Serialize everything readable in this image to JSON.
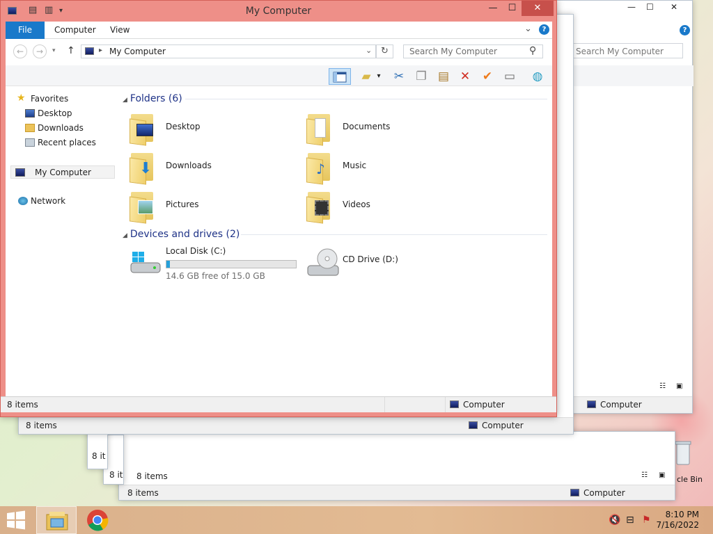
{
  "window": {
    "title": "My Computer",
    "caption_min": "—",
    "caption_max": "☐",
    "caption_close": "✕"
  },
  "ribbon": {
    "tabs": [
      "File",
      "Computer",
      "View"
    ],
    "help": "?",
    "chevron": "⌄"
  },
  "address": {
    "back": "←",
    "forward": "→",
    "up": "↑",
    "path": "My Computer",
    "refresh": "↻",
    "search_placeholder": "Search My Computer",
    "search_icon": "⚲"
  },
  "toolbar_icons": [
    "layout-icon",
    "properties-icon",
    "cut-icon",
    "copy-icon",
    "paste-icon",
    "delete-icon",
    "check-icon",
    "rename-icon",
    "globe-icon"
  ],
  "nav": {
    "favorites": "Favorites",
    "desktop": "Desktop",
    "downloads": "Downloads",
    "recent": "Recent places",
    "my_computer": "My Computer",
    "network": "Network"
  },
  "folders": {
    "header": "Folders (6)",
    "items": [
      "Desktop",
      "Documents",
      "Downloads",
      "Music",
      "Pictures",
      "Videos"
    ]
  },
  "drives": {
    "header": "Devices and drives (2)",
    "local": {
      "name": "Local Disk (C:)",
      "free": "14.6 GB free of 15.0 GB",
      "used_fraction": 0.027
    },
    "cd": {
      "name": "CD Drive (D:)"
    }
  },
  "status": {
    "count": "8 items",
    "location": "Computer"
  },
  "taskbar": {
    "time": "8:10 PM",
    "date": "7/16/2022"
  },
  "desktop": {
    "recycle_label": "cle Bin"
  },
  "colors": {
    "accent": "#1979ca",
    "active_frame": "#ee8f88",
    "close_button": "#c7504b",
    "drive_fill": "#26a0da"
  }
}
